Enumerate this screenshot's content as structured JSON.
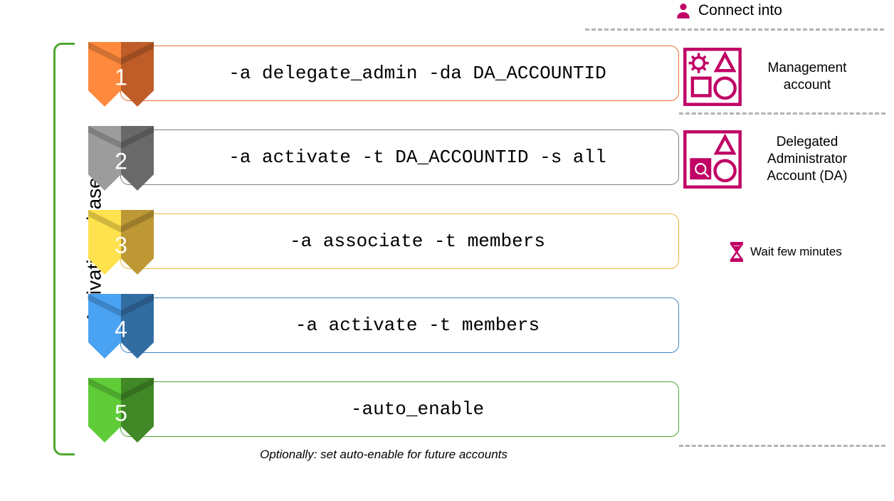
{
  "vertical_label": "Activation phase",
  "connect_label": "Connect into",
  "steps": [
    {
      "num": "1",
      "cmd": "-a delegate_admin -da DA_ACCOUNTID",
      "color": "#e97132",
      "note": null
    },
    {
      "num": "2",
      "cmd": "-a activate -t DA_ACCOUNTID -s all",
      "color": "#808080",
      "note": null
    },
    {
      "num": "3",
      "cmd": "-a associate -t members",
      "color": "#e8b93f",
      "note": null
    },
    {
      "num": "4",
      "cmd": "-a activate -t members",
      "color": "#3d85c6",
      "note": null
    },
    {
      "num": "5",
      "cmd": "-auto_enable",
      "color": "#4ea72e",
      "note": "Optionally: set auto-enable for future accounts"
    }
  ],
  "accounts": {
    "mgmt": "Management account",
    "da": "Delegated Administrator Account (DA)"
  },
  "wait_label": "Wait few minutes",
  "colors": {
    "magenta": "#c00065"
  }
}
